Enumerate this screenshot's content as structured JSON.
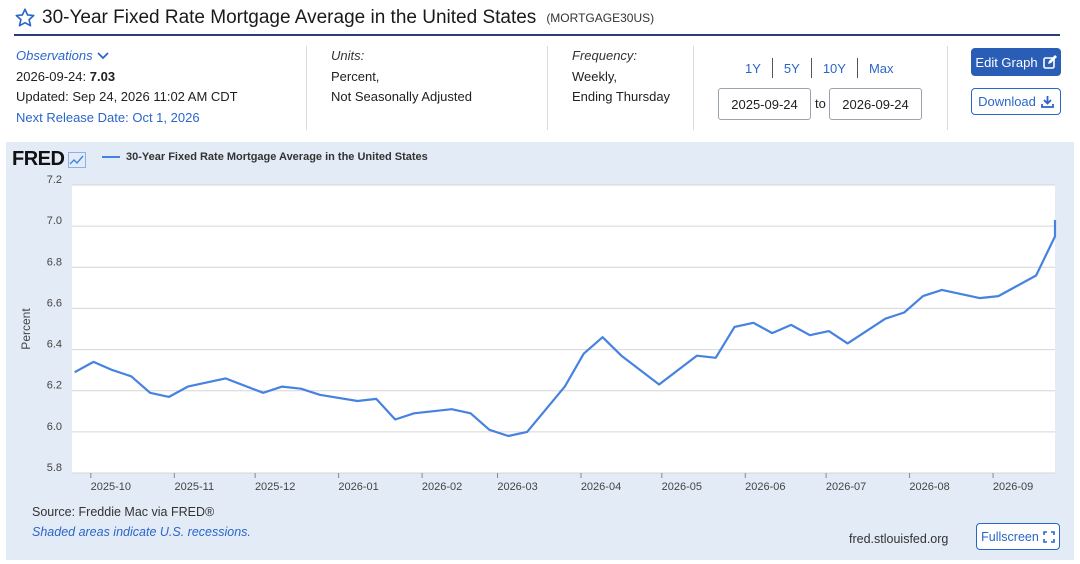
{
  "header": {
    "title": "30-Year Fixed Rate Mortgage Average in the United States",
    "series_code": "(MORTGAGE30US)"
  },
  "observations": {
    "label": "Observations",
    "date_prefix": "2026-09-24:",
    "value": "7.03",
    "updated": "Updated: Sep 24, 2026 11:02 AM CDT",
    "next_release": "Next Release Date: Oct 1, 2026"
  },
  "units": {
    "label": "Units:",
    "line1": "Percent,",
    "line2": "Not Seasonally Adjusted"
  },
  "frequency": {
    "label": "Frequency:",
    "line1": "Weekly,",
    "line2": "Ending Thursday"
  },
  "range": {
    "tabs": [
      "1Y",
      "5Y",
      "10Y",
      "Max"
    ],
    "start_date": "2025-09-24",
    "to_label": "to",
    "end_date": "2026-09-24"
  },
  "buttons": {
    "edit_graph": "Edit Graph",
    "download": "Download",
    "fullscreen": "Fullscreen"
  },
  "logo": {
    "text": "FRED"
  },
  "footer": {
    "source": "Source: Freddie Mac via FRED®",
    "recession_note": "Shaded areas indicate U.S. recessions.",
    "url": "fred.stlouisfed.org"
  },
  "colors": {
    "accent": "#2a66c9",
    "line": "#4682e0",
    "panel": "#e3ebf6",
    "button": "#2a5db5"
  },
  "chart_data": {
    "type": "line",
    "ylabel": "Percent",
    "ylim": [
      5.8,
      7.2
    ],
    "yticks": [
      5.8,
      6.0,
      6.2,
      6.4,
      6.6,
      6.8,
      7.0,
      7.2
    ],
    "xticks": [
      "2025-10-01",
      "2025-11-01",
      "2025-12-01",
      "2026-01-01",
      "2026-02-01",
      "2026-03-01",
      "2026-04-01",
      "2026-05-01",
      "2026-06-01",
      "2026-07-01",
      "2026-08-01",
      "2026-09-01"
    ],
    "xtick_labels": [
      "2025-10",
      "2025-11",
      "2025-12",
      "2026-01",
      "2026-02",
      "2026-03",
      "2026-04",
      "2026-05",
      "2026-06",
      "2026-07",
      "2026-08",
      "2026-09"
    ],
    "grid": true,
    "legend": "top-left",
    "series": [
      {
        "name": "30-Year Fixed Rate Mortgage Average in the United States",
        "x": [
          "2025-09-25",
          "2025-10-02",
          "2025-10-09",
          "2025-10-16",
          "2025-10-23",
          "2025-10-30",
          "2025-11-06",
          "2025-11-20",
          "2025-12-04",
          "2025-12-11",
          "2025-12-18",
          "2025-12-25",
          "2026-01-08",
          "2026-01-15",
          "2026-01-22",
          "2026-01-29",
          "2026-02-12",
          "2026-02-19",
          "2026-02-26",
          "2026-03-05",
          "2026-03-12",
          "2026-03-26",
          "2026-04-02",
          "2026-04-09",
          "2026-04-16",
          "2026-04-30",
          "2026-05-14",
          "2026-05-21",
          "2026-05-28",
          "2026-06-04",
          "2026-06-11",
          "2026-06-18",
          "2026-06-25",
          "2026-07-02",
          "2026-07-09",
          "2026-07-23",
          "2026-07-30",
          "2026-08-06",
          "2026-08-13",
          "2026-08-27",
          "2026-09-03",
          "2026-09-17",
          "2026-09-24"
        ],
        "y": [
          6.29,
          6.34,
          6.3,
          6.27,
          6.19,
          6.17,
          6.22,
          6.26,
          6.19,
          6.22,
          6.21,
          6.18,
          6.15,
          6.16,
          6.06,
          6.09,
          6.11,
          6.09,
          6.01,
          5.98,
          6.0,
          6.22,
          6.38,
          6.46,
          6.37,
          6.23,
          6.37,
          6.36,
          6.51,
          6.53,
          6.48,
          6.52,
          6.47,
          6.49,
          6.43,
          6.55,
          6.58,
          6.66,
          6.69,
          6.65,
          6.66,
          6.76,
          6.95
        ]
      }
    ],
    "last_point": {
      "x": "2026-09-24",
      "y": 7.03
    }
  }
}
